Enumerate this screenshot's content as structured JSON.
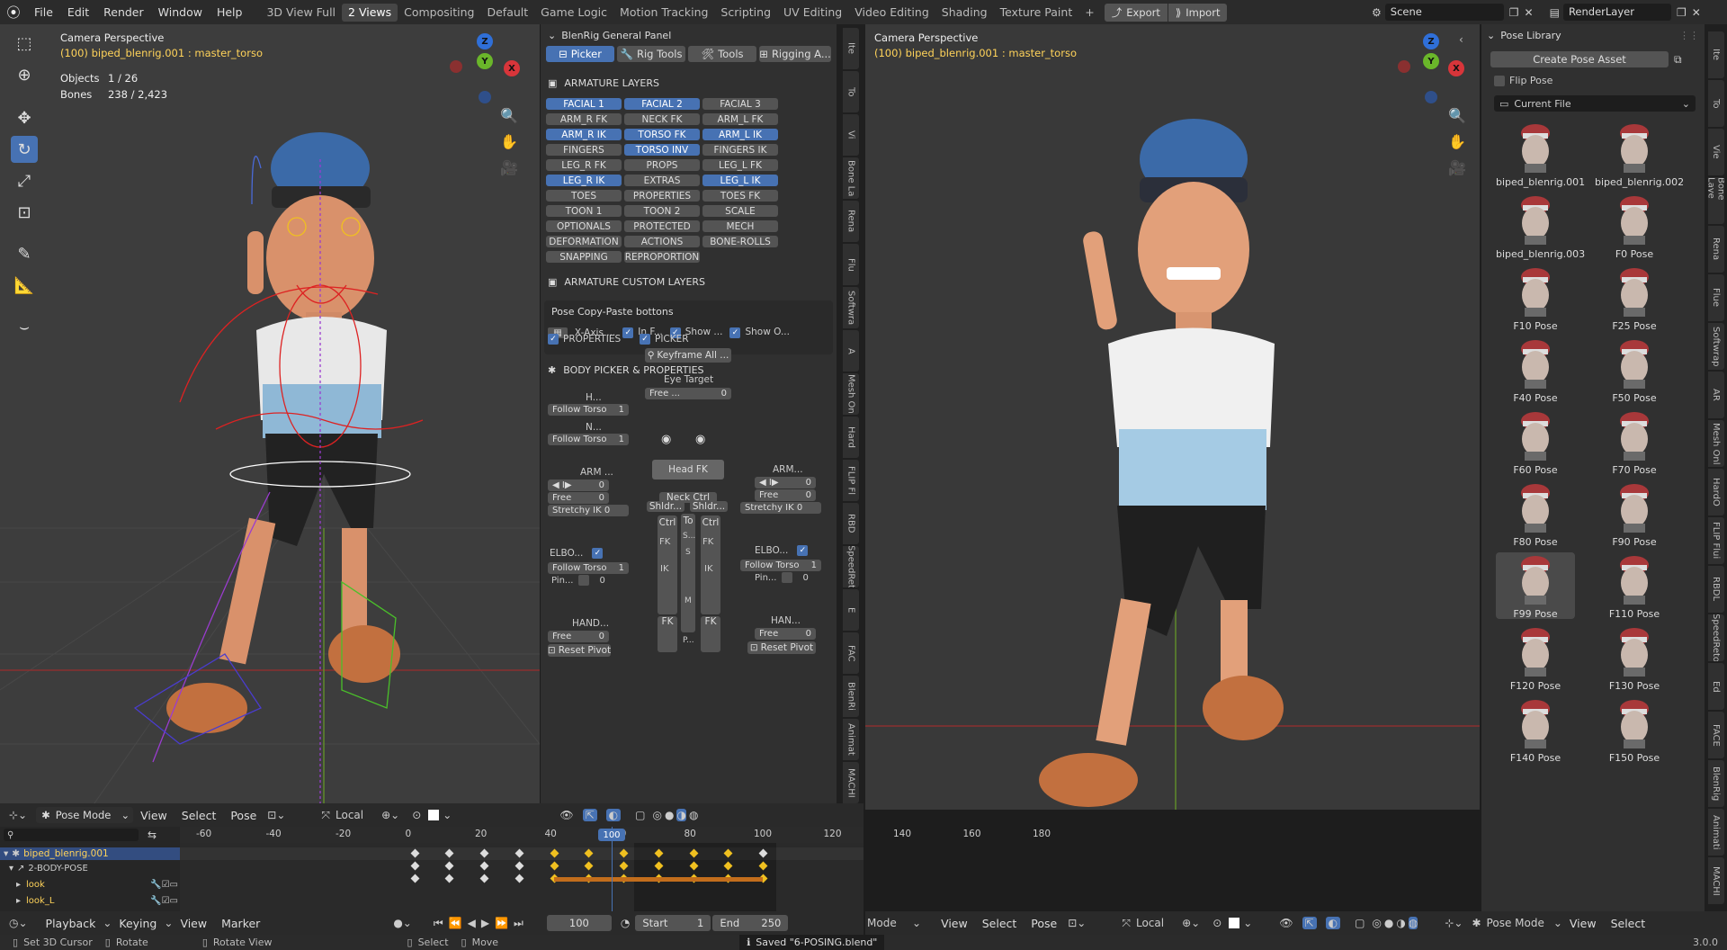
{
  "menu": {
    "file": "File",
    "edit": "Edit",
    "render": "Render",
    "window": "Window",
    "help": "Help"
  },
  "workspaces": [
    "3D View Full",
    "2 Views",
    "Compositing",
    "Default",
    "Game Logic",
    "Motion Tracking",
    "Scripting",
    "UV Editing",
    "Video Editing",
    "Shading",
    "Texture Paint",
    "+"
  ],
  "export_label": "Export",
  "import_label": "Import",
  "scene": "Scene",
  "render_layer": "RenderLayer",
  "left_vp": {
    "title": "Camera Perspective",
    "subtitle": "(100) biped_blenrig.001 : master_torso",
    "objects_label": "Objects",
    "objects_val": "1 / 26",
    "bones_label": "Bones",
    "bones_val": "238 / 2,423"
  },
  "right_vp": {
    "title": "Camera Perspective",
    "subtitle": "(100) biped_blenrig.001 : master_torso"
  },
  "gizmo": {
    "z": "Z",
    "y": "Y",
    "x": "X"
  },
  "panel": {
    "title": "BlenRig General Panel",
    "tabs": [
      "Picker",
      "Rig Tools",
      "Tools",
      "Rigging A..."
    ],
    "armature_layers": "ARMATURE LAYERS",
    "layers": [
      [
        "FACIAL 1",
        "FACIAL 2",
        "FACIAL 3"
      ],
      [
        "ARM_R FK",
        "NECK FK",
        "ARM_L FK"
      ],
      [
        "ARM_R IK",
        "TORSO FK",
        "ARM_L IK"
      ],
      [
        "FINGERS",
        "TORSO INV",
        "FINGERS IK"
      ],
      [
        "LEG_R FK",
        "PROPS",
        "LEG_L FK"
      ],
      [
        "LEG_R IK",
        "EXTRAS",
        "LEG_L IK"
      ],
      [
        "TOES",
        "PROPERTIES",
        "TOES FK"
      ],
      [
        "TOON 1",
        "TOON 2",
        "SCALE"
      ],
      [
        "OPTIONALS",
        "PROTECTED",
        "MECH"
      ],
      [
        "DEFORMATION",
        "ACTIONS",
        "BONE-ROLLS"
      ],
      [
        "SNAPPING",
        "REPROPORTION",
        ""
      ]
    ],
    "custom_layers": "ARMATURE CUSTOM LAYERS",
    "copy_paste": "Pose Copy-Paste bottons",
    "xaxis": "X-Axis ...",
    "inf": "In F...",
    "show1": "Show ...",
    "show2": "Show O...",
    "body_picker": "BODY PICKER & PROPERTIES",
    "properties": "PROPERTIES",
    "picker": "PICKER",
    "keyframe_all": "Keyframe All ...",
    "eye_target": "Eye Target",
    "free": "Free ...",
    "zero": "0",
    "h": "H...",
    "n": "N...",
    "follow_torso": "Follow Torso",
    "one": "1",
    "head_fk": "Head FK",
    "arm_l": "ARM ...",
    "arm_r": "ARM...",
    "free_lbl": "Free",
    "stretchy": "Stretchy IK 0",
    "neck_ctrl": "Neck Ctrl",
    "shldr": "Shldr...",
    "ctrl": "Ctrl",
    "to": "To",
    "fk": "FK",
    "ik": "IK",
    "s": "S...",
    "s2": "S",
    "m": "M",
    "p": "P...",
    "elbo_l": "ELBO...",
    "elbo_r": "ELBO...",
    "pin": "Pin...",
    "hand_l": "HAND...",
    "hand_r": "HAN...",
    "reset_pivot": "Reset Pivot"
  },
  "side_tabs_mid": [
    "Ite",
    "To",
    "Vi",
    "Bone La",
    "Rena",
    "Flu",
    "Softwra",
    "A",
    "Mesh On",
    "Hard",
    "FLIP Fl",
    "RBD",
    "SpeedRet",
    "E",
    "FAC",
    "BlenRi",
    "Animat",
    "MACHI"
  ],
  "side_tabs_right": [
    "Ite",
    "To",
    "Vie",
    "Bone Laye",
    "Rena",
    "Flue",
    "Softwrap",
    "AR",
    "Mesh Onl",
    "HardO",
    "FLIP Flui",
    "RBDL",
    "SpeedReto",
    "Ed",
    "FACE",
    "BlenRig",
    "Animati",
    "MACHI"
  ],
  "pose_lib": {
    "title": "Pose Library",
    "create": "Create Pose Asset",
    "flip": "Flip Pose",
    "current": "Current File",
    "poses": [
      "biped_blenrig.001",
      "biped_blenrig.002",
      "biped_blenrig.003",
      "F0 Pose",
      "F10 Pose",
      "F25 Pose",
      "F40 Pose",
      "F50 Pose",
      "F60 Pose",
      "F70 Pose",
      "F80 Pose",
      "F90 Pose",
      "F99 Pose",
      "F110 Pose",
      "F120 Pose",
      "F130 Pose",
      "F140 Pose",
      "F150 Pose"
    ],
    "selected": "F99 Pose"
  },
  "vp_header": {
    "mode": "Pose Mode",
    "view": "View",
    "select": "Select",
    "pose": "Pose",
    "local": "Local",
    "mode_r": "Mode"
  },
  "timeline": {
    "ticks": [
      "-60",
      "-40",
      "-20",
      "0",
      "20",
      "40",
      "60",
      "80",
      "100",
      "120",
      "140",
      "160",
      "180"
    ],
    "current": "100",
    "channels": [
      "biped_blenrig.001",
      "2-BODY-POSE",
      "look",
      "look_L"
    ],
    "playback": "Playback",
    "keying": "Keying",
    "view": "View",
    "marker": "Marker",
    "frame": "100",
    "start_label": "Start",
    "start": "1",
    "end_label": "End",
    "end": "250"
  },
  "status": {
    "cursor": "Set 3D Cursor",
    "rotate": "Rotate",
    "rotate_view": "Rotate View",
    "select": "Select",
    "move": "Move",
    "saved": "Saved \"6-POSING.blend\"",
    "version": "3.0.0"
  },
  "colors": {
    "accent": "#4772b3",
    "header": "#2b2b2b",
    "viewport": "#3d3d3d",
    "panel": "#303030"
  }
}
